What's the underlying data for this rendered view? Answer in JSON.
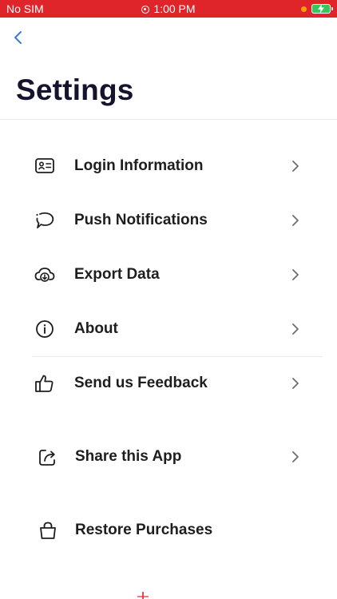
{
  "status_bar": {
    "carrier": "No SIM",
    "time": "1:00 PM",
    "status_color": "#e0252a"
  },
  "nav": {
    "back_icon": "chevron-left-icon",
    "accent": "#3a7bd5"
  },
  "title": "Settings",
  "items": [
    {
      "label": "Login Information",
      "icon": "id-card-icon"
    },
    {
      "label": "Push Notifications",
      "icon": "chat-bubble-icon"
    },
    {
      "label": "Export Data",
      "icon": "cloud-download-icon"
    },
    {
      "label": "About",
      "icon": "info-circle-icon"
    },
    {
      "label": "Send us Feedback",
      "icon": "thumbs-up-icon"
    },
    {
      "label": "Share this App",
      "icon": "share-icon"
    },
    {
      "label": "Restore Purchases",
      "icon": "shopping-bag-icon"
    }
  ]
}
